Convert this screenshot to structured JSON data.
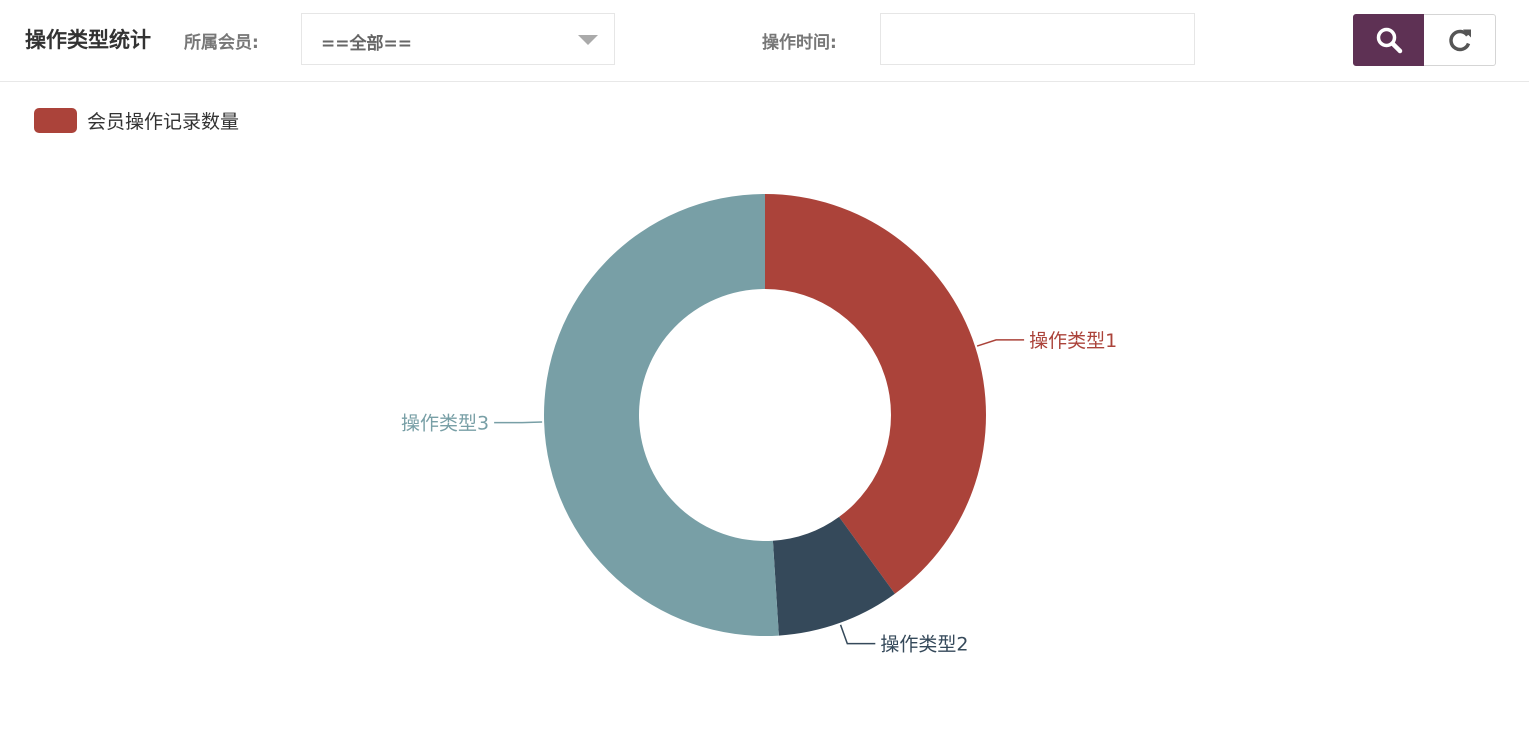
{
  "header": {
    "title": "操作类型统计",
    "member_label": "所属会员:",
    "member_select_value": "==全部==",
    "time_label": "操作时间:",
    "time_value": "",
    "search_icon": "search-icon",
    "refresh_icon": "refresh-icon"
  },
  "colors": {
    "accent": "#5e3154",
    "type1": "#ab433a",
    "type2": "#35495a",
    "type3": "#789fa6"
  },
  "chart_data": {
    "type": "pie",
    "variant": "donut",
    "legend": [
      "会员操作记录数量"
    ],
    "legend_placement": "top-left",
    "legend_color": "#ab433a",
    "slices": [
      {
        "label": "操作类型1",
        "value": 40,
        "color": "#ab433a"
      },
      {
        "label": "操作类型2",
        "value": 9,
        "color": "#35495a"
      },
      {
        "label": "操作类型3",
        "value": 51,
        "color": "#789fa6"
      }
    ]
  }
}
